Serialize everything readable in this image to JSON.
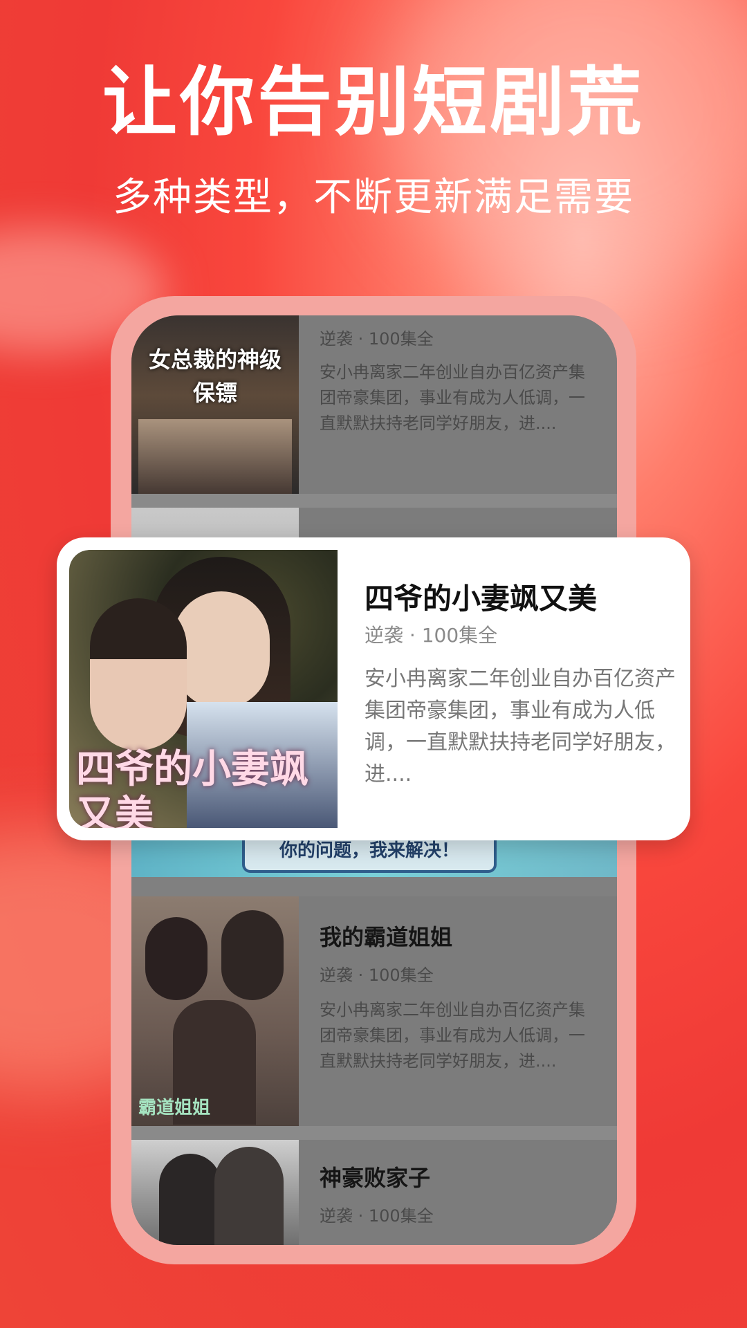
{
  "headline": "让你告别短剧荒",
  "subheadline": "多种类型，不断更新满足需要",
  "featured": {
    "title": "四爷的小妻飒又美",
    "meta": "逆袭 · 100集全",
    "description": "安小冉离家二年创业自办百亿资产集团帝豪集团，事业有成为人低调，一直默默扶持老同学好朋友，进....",
    "poster_text": "四爷的小妻飒又美"
  },
  "list": [
    {
      "title": "",
      "meta": "逆袭 · 100集全",
      "description": "安小冉离家二年创业自办百亿资产集团帝豪集团，事业有成为人低调，一直默默扶持老同学好朋友，进....",
      "poster_text": "女总裁的神级保镖"
    },
    {
      "title": "我的霸道姐姐",
      "meta": "逆袭 · 100集全",
      "description": "安小冉离家二年创业自办百亿资产集团帝豪集团，事业有成为人低调，一直默默扶持老同学好朋友，进....",
      "poster_text": "霸道姐姐"
    },
    {
      "title": "神豪败家子",
      "meta": "逆袭 · 100集全",
      "description": "",
      "poster_text": ""
    }
  ],
  "banner_text": "你的问题，我来解决！",
  "colors": {
    "accent": "#f4423b",
    "phone_frame": "#f4a6a0",
    "card_bg": "#ffffff"
  }
}
